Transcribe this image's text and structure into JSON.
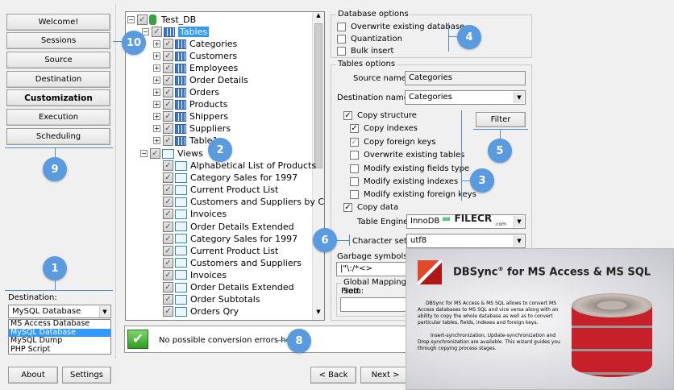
{
  "nav": {
    "items": [
      "Welcome!",
      "Sessions",
      "Source",
      "Destination",
      "Customization",
      "Execution",
      "Scheduling"
    ],
    "active": "Customization"
  },
  "destination": {
    "label": "Destination:",
    "selected": "MySQL Database",
    "options": [
      "MS Access Database",
      "MySQL Database",
      "MySQL Dump",
      "PHP Script"
    ]
  },
  "footer": {
    "about": "About",
    "settings": "Settings",
    "back": "< Back",
    "next": "Next >"
  },
  "tree": {
    "root": "Test_DB",
    "tables_label": "Tables",
    "tables": [
      "Categories",
      "Customers",
      "Employees",
      "Order Details",
      "Orders",
      "Products",
      "Shippers",
      "Suppliers",
      "Table1"
    ],
    "views_label": "Views",
    "views": [
      "Alphabetical List of Products",
      "Category Sales for 1997",
      "Current Product List",
      "Customers and Suppliers by City",
      "Invoices",
      "Order Details Extended",
      "Category Sales for 1997",
      "Current Product List",
      "Customers and Suppliers",
      "Invoices",
      "Order Details Extended",
      "Order Subtotals",
      "Orders Qry"
    ]
  },
  "db_options": {
    "title": "Database options",
    "items": [
      {
        "label": "Overwrite existing database",
        "checked": false
      },
      {
        "label": "Quantization",
        "checked": false
      },
      {
        "label": "Bulk insert",
        "checked": false
      }
    ]
  },
  "tables_options": {
    "title": "Tables options",
    "source_label": "Source name:",
    "source_value": "Categories",
    "dest_label": "Destination name:",
    "dest_value": "Categories",
    "filter": "Filter",
    "checks": [
      {
        "label": "Copy structure",
        "checked": true
      },
      {
        "label": "Copy indexes",
        "checked": true
      },
      {
        "label": "Copy foreign keys",
        "checked": true
      },
      {
        "label": "Overwrite existing tables",
        "checked": false
      },
      {
        "label": "Modify existing fields type",
        "checked": false
      },
      {
        "label": "Modify existing indexes",
        "checked": false
      },
      {
        "label": "Modify existing foreign keys",
        "checked": false
      },
      {
        "label": "Copy data",
        "checked": true
      }
    ],
    "engine_label": "Table Engine:",
    "engine_value": "InnoDB",
    "charset_label": "Character set:",
    "charset_value": "utf8",
    "garbage_label": "Garbage symbols to r",
    "garbage_value": "|\"\\:/*<>",
    "mapping_label": "Global Mapping Sett",
    "from_label": "From:"
  },
  "status": {
    "message": "No possible conversion errors here."
  },
  "watermark": {
    "text": "FILECR",
    "sub": ".com"
  },
  "splash": {
    "title": "DBSync",
    "reg": "®",
    "title_rest": " for MS Access & MS SQL",
    "p1": "DBSync for MS Access & MS SQL allows to convert MS Access databases to MS SQL and vice versa along with an ability to copy the whole database as well as to convert particular tables, fields, indexes and foreign keys.",
    "p2": "Insert-synchronization, Update-synchronization and Drop-synchronization are available. This wizard guides you through copying process stages."
  },
  "callouts": [
    "1",
    "2",
    "3",
    "4",
    "5",
    "6",
    "8",
    "9",
    "10"
  ],
  "colors": {
    "accent": "#5a9be0",
    "selection": "#3399ff"
  }
}
